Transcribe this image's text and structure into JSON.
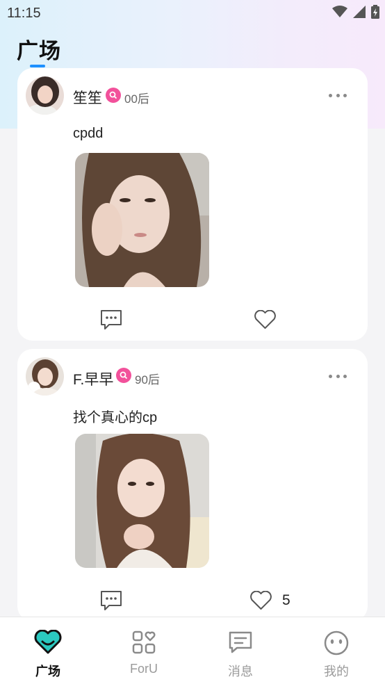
{
  "status_bar": {
    "time": "11:15"
  },
  "header": {
    "title": "广场"
  },
  "posts": [
    {
      "username": "笙笙",
      "age_tag": "00后",
      "text": "cpdd",
      "likes": ""
    },
    {
      "username": "F.早早",
      "age_tag": "90后",
      "text": "找个真心的cp",
      "likes": "5"
    }
  ],
  "tabbar": {
    "items": [
      {
        "label": "广场",
        "icon": "plaza-heart-icon"
      },
      {
        "label": "ForU",
        "icon": "grid-heart-icon"
      },
      {
        "label": "消息",
        "icon": "message-icon"
      },
      {
        "label": "我的",
        "icon": "profile-face-icon"
      }
    ],
    "active": 0
  },
  "colors": {
    "accent": "#1e90ff",
    "badge": "#f2519b",
    "active_tab_icon": "#2bc9c0"
  }
}
